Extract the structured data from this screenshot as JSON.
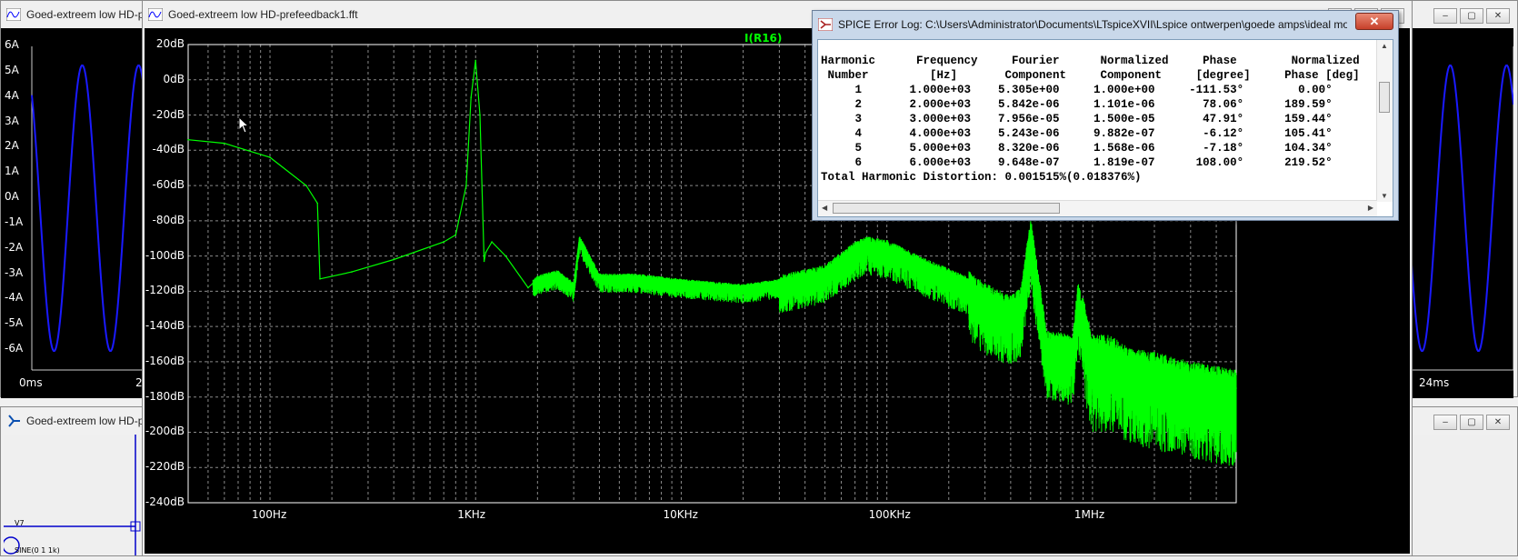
{
  "colors": {
    "trace": "#00ff00",
    "wave": "#1a1aff",
    "grid": "#8a8a8a",
    "plot_bg": "#000000",
    "axis_text": "#ffffff"
  },
  "back_left": {
    "title": "Goed-extreem low HD-pr",
    "y_ticks": [
      "6A",
      "5A",
      "4A",
      "3A",
      "2A",
      "1A",
      "0A",
      "-1A",
      "-2A",
      "-3A",
      "-4A",
      "-5A",
      "-6A"
    ],
    "x_ticks": [
      "0ms",
      "2"
    ]
  },
  "back_right": {
    "x_ticks": [
      "24ms"
    ]
  },
  "schematic": {
    "title": "Goed-extreem low HD-pr",
    "component": "V7",
    "source_label": "SINE(0 1 1k)"
  },
  "fft_window": {
    "title": "Goed-extreem low HD-prefeedback1.fft",
    "trace_label": "I(R16)"
  },
  "chart_data": {
    "type": "line",
    "title": "",
    "xlabel": "",
    "ylabel": "",
    "x_scale": "log",
    "xlim": [
      40,
      5000000
    ],
    "ylim": [
      -240,
      20
    ],
    "grid": true,
    "y_ticks": [
      "20dB",
      "0dB",
      "-20dB",
      "-40dB",
      "-60dB",
      "-80dB",
      "-100dB",
      "-120dB",
      "-140dB",
      "-160dB",
      "-180dB",
      "-200dB",
      "-220dB",
      "-240dB"
    ],
    "x_ticks": [
      "100Hz",
      "1KHz",
      "10KHz",
      "100KHz",
      "1MHz"
    ],
    "series": [
      {
        "name": "I(R16)",
        "x": [
          40,
          60,
          100,
          150,
          170,
          175,
          250,
          400,
          700,
          800,
          900,
          950,
          1000,
          1050,
          1100,
          1120,
          1200,
          1400,
          1800,
          2000,
          2500,
          3000,
          3200,
          4000,
          6000,
          10000,
          20000,
          30000,
          50000,
          60000,
          70000,
          80000,
          100000,
          150000,
          250000,
          300000,
          400000,
          450000,
          500000,
          600000,
          800000,
          850000,
          1000000,
          1200000,
          1500000,
          2000000,
          3000000,
          5000000
        ],
        "y": [
          -34,
          -36,
          -44,
          -60,
          -70,
          -113,
          -109,
          -102,
          -92,
          -88,
          -60,
          -10,
          11,
          -20,
          -103,
          -98,
          -92,
          -100,
          -118,
          -113,
          -110,
          -117,
          -90,
          -112,
          -112,
          -115,
          -118,
          -115,
          -109,
          -102,
          -96,
          -93,
          -95,
          -105,
          -116,
          -123,
          -130,
          -125,
          -85,
          -150,
          -152,
          -122,
          -155,
          -155,
          -162,
          -165,
          -170,
          -175
        ]
      }
    ]
  },
  "error_log": {
    "title": "SPICE Error Log: C:\\Users\\Administrator\\Documents\\LTspiceXVII\\Lspice ontwerpen\\goede amps\\ideal mo...",
    "close_label": "✕",
    "header1": "Harmonic      Frequency     Fourier      Normalized     Phase        Normalized",
    "header2": " Number         [Hz]       Component     Component     [degree]     Phase [deg]",
    "rows": [
      {
        "n": "1",
        "freq": "1.000e+03",
        "fourier": "5.305e+00",
        "norm": "1.000e+00",
        "phase": "-111.53°",
        "nphase": "0.00°"
      },
      {
        "n": "2",
        "freq": "2.000e+03",
        "fourier": "5.842e-06",
        "norm": "1.101e-06",
        "phase": "78.06°",
        "nphase": "189.59°"
      },
      {
        "n": "3",
        "freq": "3.000e+03",
        "fourier": "7.956e-05",
        "norm": "1.500e-05",
        "phase": "47.91°",
        "nphase": "159.44°"
      },
      {
        "n": "4",
        "freq": "4.000e+03",
        "fourier": "5.243e-06",
        "norm": "9.882e-07",
        "phase": "-6.12°",
        "nphase": "105.41°"
      },
      {
        "n": "5",
        "freq": "5.000e+03",
        "fourier": "8.320e-06",
        "norm": "1.568e-06",
        "phase": "-7.18°",
        "nphase": "104.34°"
      },
      {
        "n": "6",
        "freq": "6.000e+03",
        "fourier": "9.648e-07",
        "norm": "1.819e-07",
        "phase": "108.00°",
        "nphase": "219.52°"
      }
    ],
    "thd": "Total Harmonic Distortion: 0.001515%(0.018376%)"
  }
}
